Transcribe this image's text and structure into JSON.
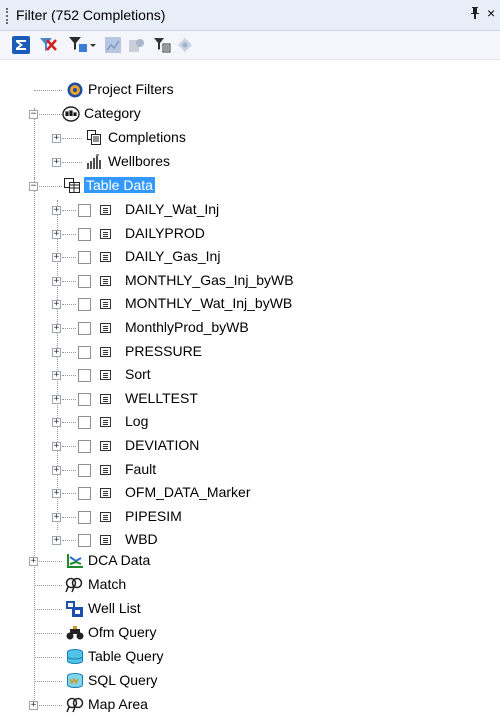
{
  "panel": {
    "title": "Filter (752 Completions)",
    "pin_glyph": "ᵖ",
    "close_glyph": "×"
  },
  "toolbar": {
    "buttons": [
      {
        "icon": "sigma-icon"
      },
      {
        "icon": "clear-filter-icon"
      },
      {
        "icon": "filter-options-icon",
        "has_dropdown": true
      },
      {
        "icon": "chart-icon"
      },
      {
        "icon": "query-icon"
      },
      {
        "icon": "filter-list-icon"
      },
      {
        "icon": "diamond-icon"
      }
    ]
  },
  "tree": {
    "project_filters": "Project Filters",
    "category": "Category",
    "completions": "Completions",
    "wellbores": "Wellbores",
    "table_data": "Table Data",
    "tables": [
      "DAILY_Wat_Inj",
      "DAILYPROD",
      "DAILY_Gas_Inj",
      "MONTHLY_Gas_Inj_byWB",
      "MONTHLY_Wat_Inj_byWB",
      "MonthlyProd_byWB",
      "PRESSURE",
      "Sort",
      "WELLTEST",
      "Log",
      "DEVIATION",
      "Fault",
      "OFM_DATA_Marker",
      "PIPESIM",
      "WBD"
    ],
    "dca_data": "DCA Data",
    "match": "Match",
    "well_list": "Well List",
    "ofm_query": "Ofm Query",
    "table_query": "Table Query",
    "sql_query": "SQL Query",
    "map_area": "Map Area"
  }
}
